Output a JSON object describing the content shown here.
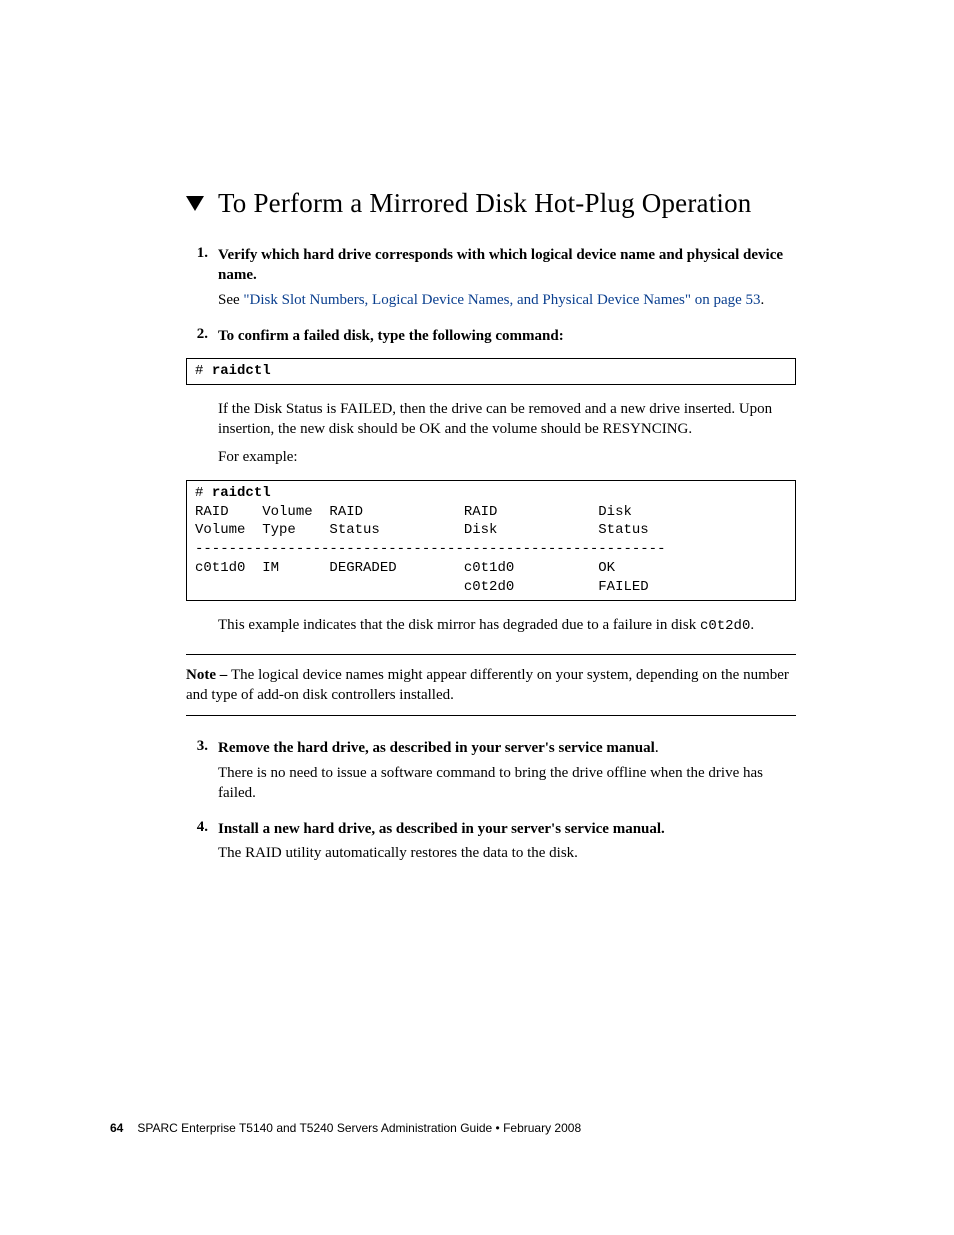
{
  "headline": "To Perform a Mirrored Disk Hot-Plug Operation",
  "steps": {
    "s1": {
      "num": "1.",
      "title": "Verify which hard drive corresponds with which logical device name and physical device name.",
      "see_prefix": "See ",
      "link": "\"Disk Slot Numbers, Logical Device Names, and Physical Device Names\" on page 53",
      "period": "."
    },
    "s2": {
      "num": "2.",
      "title": "To confirm a failed disk, type the following command:"
    },
    "s3": {
      "num": "3.",
      "title1": "Remove the hard drive, as described in your server's service manual",
      "title_period": ".",
      "body": "There is no need to issue a software command to bring the drive offline when the drive has failed."
    },
    "s4": {
      "num": "4.",
      "title": "Install a new hard drive, as described in your server's service manual.",
      "body": "The RAID utility automatically restores the data to the disk."
    }
  },
  "code1": {
    "prompt": "# ",
    "cmd": "raidctl"
  },
  "post_code1": {
    "p1": "If the Disk Status is FAILED, then the drive can be removed and a new drive inserted. Upon insertion, the new disk should be OK and the volume should be RESYNCING.",
    "p2": "For example:"
  },
  "code2": {
    "prompt": "# ",
    "cmd": "raidctl",
    "body": "RAID    Volume  RAID            RAID            Disk\nVolume  Type    Status          Disk            Status\n--------------------------------------------------------\nc0t1d0  IM      DEGRADED        c0t1d0          OK\n                                c0t2d0          FAILED\n"
  },
  "post_code2": {
    "p_pre": "This example indicates that the disk mirror has degraded due to a failure in disk ",
    "mono": "c0t2d0",
    "p_post": "."
  },
  "note": {
    "label": "Note – ",
    "body": "The logical device names might appear differently on your system, depending on the number and type of add-on disk controllers installed."
  },
  "footer": {
    "page": "64",
    "text": "SPARC Enterprise T5140 and T5240 Servers Administration Guide  •  February 2008"
  }
}
